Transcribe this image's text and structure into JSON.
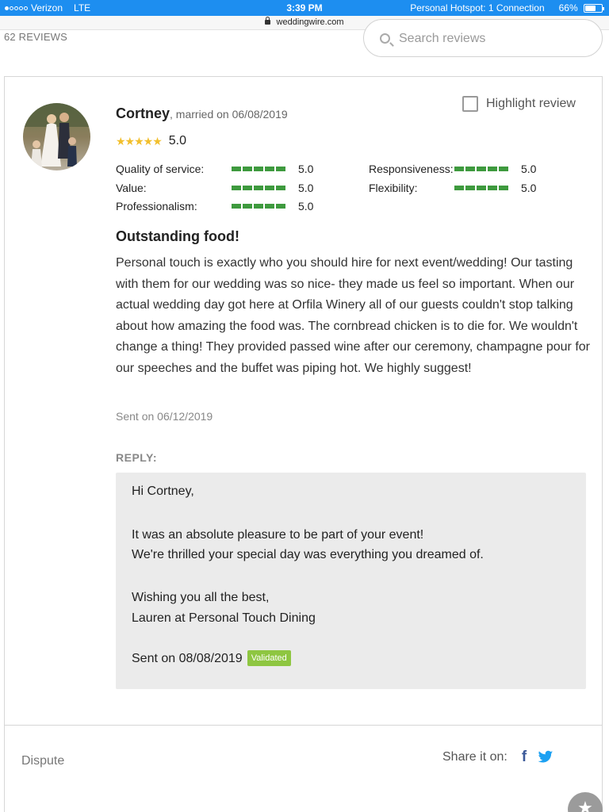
{
  "status_bar": {
    "carrier": "Verizon",
    "network": "LTE",
    "time": "3:39 PM",
    "hotspot": "Personal Hotspot: 1 Connection",
    "battery": "66%",
    "battery_level": 0.66
  },
  "browser": {
    "url": "weddingwire.com"
  },
  "reviews": {
    "count_label": "62 REVIEWS",
    "search_placeholder": "Search reviews"
  },
  "review": {
    "author": "Cortney",
    "married_text": ", married on 06/08/2019",
    "highlight_label": "Highlight review",
    "overall_rating": "5.0",
    "overall_stars": 5,
    "ratings": [
      {
        "label": "Quality of service:",
        "value": "5.0"
      },
      {
        "label": "Responsiveness:",
        "value": "5.0"
      },
      {
        "label": "Value:",
        "value": "5.0"
      },
      {
        "label": "Flexibility:",
        "value": "5.0"
      },
      {
        "label": "Professionalism:",
        "value": "5.0"
      }
    ],
    "title": "Outstanding food!",
    "body": "Personal touch is exactly who you should hire for next event/wedding! Our tasting with them for our wedding was so nice- they made us feel so important. When our actual wedding day got here at Orfila Winery all of our guests couldn't stop talking about how amazing the food was. The cornbread chicken is to die for. We wouldn't change a thing! They provided passed wine after our ceremony, champagne pour for our speeches and the buffet was piping hot. We highly suggest!",
    "sent": "Sent on 06/12/2019"
  },
  "reply": {
    "label": "REPLY:",
    "greeting": "Hi Cortney,",
    "line1": "It was an absolute pleasure to be part of your event!",
    "line2": "We're thrilled your special day was everything you dreamed of.",
    "closing": "Wishing you all the best,",
    "signature": "Lauren at Personal Touch Dining",
    "sent": "Sent on 08/08/2019",
    "badge": "Validated"
  },
  "footer": {
    "dispute": "Dispute",
    "share_label": "Share it on:",
    "facebook_glyph": "f"
  },
  "colors": {
    "status_bar": "#1d8ef0",
    "rating_bar": "#3e9a3e",
    "star": "#f2bf2c",
    "validated": "#8ec641",
    "facebook": "#3b5998",
    "twitter": "#1da1f2"
  }
}
